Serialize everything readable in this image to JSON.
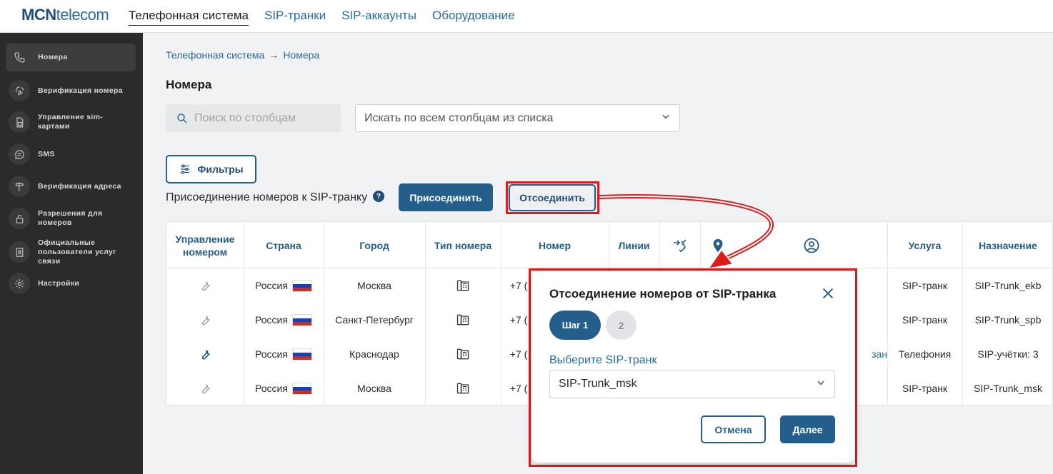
{
  "brand": {
    "logo_bold": "MCN",
    "logo_light": "telecom"
  },
  "topnav": [
    {
      "label": "Телефонная система",
      "active": true
    },
    {
      "label": "SIP-транки",
      "active": false
    },
    {
      "label": "SIP-аккаунты",
      "active": false
    },
    {
      "label": "Оборудование",
      "active": false
    }
  ],
  "sidebar": {
    "items": [
      {
        "label": "Номера",
        "icon": "phone-icon",
        "active": true
      },
      {
        "label": "Верификация номера",
        "icon": "fingerprint-icon"
      },
      {
        "label": "Управление sim-картами",
        "icon": "sim-card-icon"
      },
      {
        "label": "SMS",
        "icon": "chat-icon"
      },
      {
        "label": "Верификация адреса",
        "icon": "signpost-icon"
      },
      {
        "label": "Разрешения для номеров",
        "icon": "lock-icon"
      },
      {
        "label": "Официальные пользователи услуг связи",
        "icon": "id-card-icon"
      },
      {
        "label": "Настройки",
        "icon": "gear-icon"
      }
    ]
  },
  "breadcrumb": {
    "root": "Телефонная система",
    "separator": "→",
    "current": "Номера"
  },
  "page": {
    "title": "Номера"
  },
  "search": {
    "placeholder": "Поиск по столбцам"
  },
  "column_select": {
    "value": "Искать по всем столбцам из списка"
  },
  "filters": {
    "label": "Фильтры"
  },
  "attach": {
    "label": "Присоединение номеров к SIP-транку",
    "help": "?",
    "attach_button": "Присоединить",
    "detach_button": "Отсоединить"
  },
  "table": {
    "headers": {
      "management": "Управление номером",
      "country": "Страна",
      "city": "Город",
      "number_type": "Тип номера",
      "number": "Номер",
      "lines": "Линии",
      "service": "Услуга",
      "purpose": "Назначение"
    },
    "header_icons": [
      "call-forward-icon",
      "location-pin-icon",
      "user-circle-icon"
    ],
    "rows": [
      {
        "country": "Россия",
        "city": "Москва",
        "number": "+7 (",
        "service": "SIP-транк",
        "purpose": "SIP-Trunk_ekb",
        "extra": "",
        "wrench": "grey"
      },
      {
        "country": "Россия",
        "city": "Санкт-Петербург",
        "number": "+7 (",
        "service": "SIP-транк",
        "purpose": "SIP-Trunk_spb",
        "extra": "",
        "wrench": "grey"
      },
      {
        "country": "Россия",
        "city": "Краснодар",
        "number": "+7 (",
        "service": "Телефония",
        "purpose": "SIP-учётки: 3",
        "extra": "зан",
        "wrench": "blue"
      },
      {
        "country": "Россия",
        "city": "Москва",
        "number": "+7 (",
        "service": "SIP-транк",
        "purpose": "SIP-Trunk_msk",
        "extra": "",
        "wrench": "grey"
      }
    ]
  },
  "modal": {
    "title": "Отсоединение номеров от SIP-транка",
    "step1": "Шаг 1",
    "step2": "2",
    "trunk_label": "Выберите SIP-транк",
    "trunk_value": "SIP-Trunk_msk",
    "cancel": "Отмена",
    "next": "Далее"
  },
  "colors": {
    "accent": "#245f8c",
    "link": "#2d6aa0",
    "highlight": "#e01b1b",
    "sidebar": "#2b2b2d"
  }
}
